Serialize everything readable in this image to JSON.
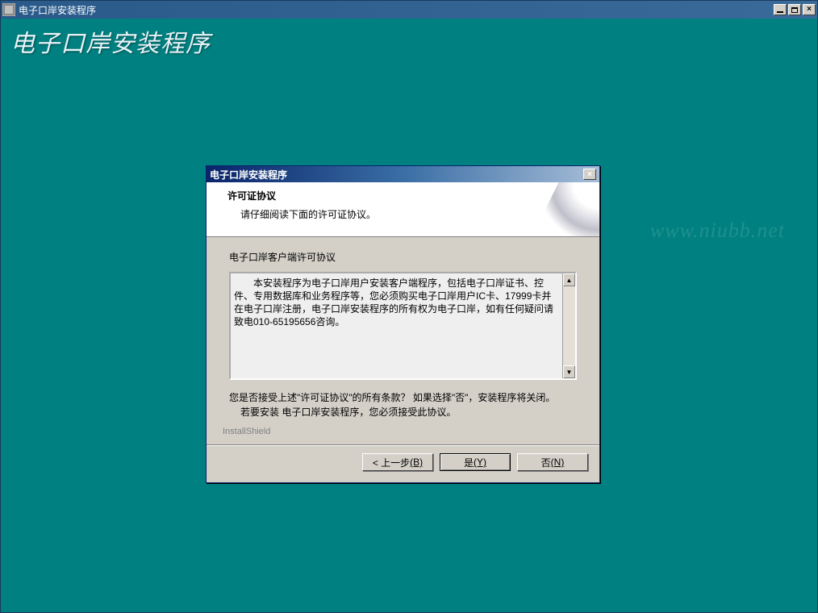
{
  "outer_window": {
    "title": "电子口岸安装程序",
    "banner": "电子口岸安装程序"
  },
  "watermark": "www.niubb.net",
  "dialog": {
    "title": "电子口岸安装程序",
    "header_title": "许可证协议",
    "header_subtitle": "请仔细阅读下面的许可证协议。",
    "section_label": "电子口岸客户端许可协议",
    "agreement_text": "本安装程序为电子口岸用户安装客户端程序，包括电子口岸证书、控件、专用数据库和业务程序等，您必须购买电子口岸用户IC卡、17999卡并在电子口岸注册，电子口岸安装程序的所有权为电子口岸，如有任何疑问请致电010-65195656咨询。",
    "accept_line1": "您是否接受上述\"许可证协议\"的所有条款？  如果选择\"否\"，安装程序将关闭。",
    "accept_line2": "若要安装 电子口岸安装程序，您必须接受此协议。",
    "installshield": "InstallShield",
    "buttons": {
      "back_prefix": "< 上一步",
      "back_hotkey": "(B)",
      "yes_prefix": "是",
      "yes_hotkey": "(Y)",
      "no_prefix": "否",
      "no_hotkey": "(N)"
    }
  }
}
